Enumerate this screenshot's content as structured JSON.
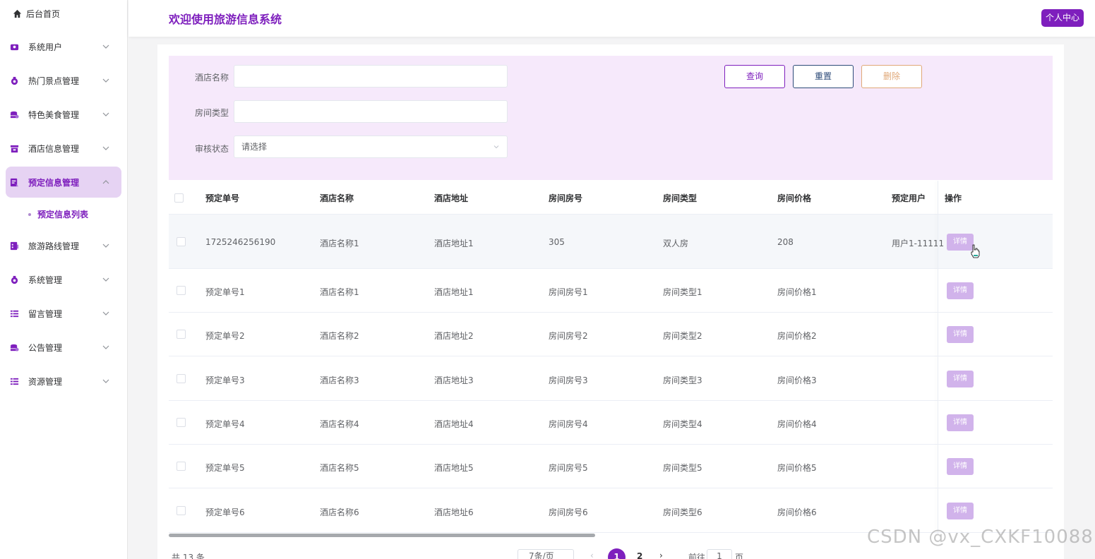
{
  "sidebar": {
    "home_label": "后台首页",
    "items": [
      {
        "label": "系统用户",
        "icon": "user-icon"
      },
      {
        "label": "热门景点管理",
        "icon": "spot-icon"
      },
      {
        "label": "特色美食管理",
        "icon": "food-icon"
      },
      {
        "label": "酒店信息管理",
        "icon": "hotel-icon"
      },
      {
        "label": "预定信息管理",
        "icon": "booking-icon"
      },
      {
        "label": "旅游路线管理",
        "icon": "route-icon"
      },
      {
        "label": "系统管理",
        "icon": "system-icon"
      },
      {
        "label": "留言管理",
        "icon": "message-icon"
      },
      {
        "label": "公告管理",
        "icon": "notice-icon"
      },
      {
        "label": "资源管理",
        "icon": "resource-icon"
      }
    ],
    "active_submenu": "预定信息列表"
  },
  "header": {
    "title": "欢迎使用旅游信息系统",
    "user_center": "个人中心"
  },
  "search": {
    "hotel_name_label": "酒店名称",
    "hotel_name_value": "",
    "room_type_label": "房间类型",
    "room_type_value": "",
    "status_label": "审核状态",
    "status_placeholder": "请选择",
    "query_button": "查询",
    "reset_button": "重置",
    "delete_button": "删除"
  },
  "table": {
    "columns": [
      "预定单号",
      "酒店名称",
      "酒店地址",
      "房间房号",
      "房间类型",
      "房间价格",
      "预定用户",
      "操作"
    ],
    "rows": [
      [
        "1725246256190",
        "酒店名称1",
        "酒店地址1",
        "305",
        "双人房",
        "208",
        "用户1-11111"
      ],
      [
        "预定单号1",
        "酒店名称1",
        "酒店地址1",
        "房间房号1",
        "房间类型1",
        "房间价格1",
        ""
      ],
      [
        "预定单号2",
        "酒店名称2",
        "酒店地址2",
        "房间房号2",
        "房间类型2",
        "房间价格2",
        ""
      ],
      [
        "预定单号3",
        "酒店名称3",
        "酒店地址3",
        "房间房号3",
        "房间类型3",
        "房间价格3",
        ""
      ],
      [
        "预定单号4",
        "酒店名称4",
        "酒店地址4",
        "房间房号4",
        "房间类型4",
        "房间价格4",
        ""
      ],
      [
        "预定单号5",
        "酒店名称5",
        "酒店地址5",
        "房间房号5",
        "房间类型5",
        "房间价格5",
        ""
      ],
      [
        "预定单号6",
        "酒店名称6",
        "酒店地址6",
        "房间房号6",
        "房间类型6",
        "房间价格6",
        ""
      ]
    ],
    "detail_button": "详情"
  },
  "pagination": {
    "total": "共 13 条",
    "page_size": "7条/页",
    "pages": [
      "1",
      "2"
    ],
    "goto_prefix": "前往",
    "goto_value": "1",
    "goto_suffix": "页"
  },
  "watermark": "CSDN @vx_CXKF10088",
  "colors": {
    "accent": "#7e1fbd",
    "search_bg": "#f6e9fb",
    "detail_button": "#d1b3eb"
  }
}
